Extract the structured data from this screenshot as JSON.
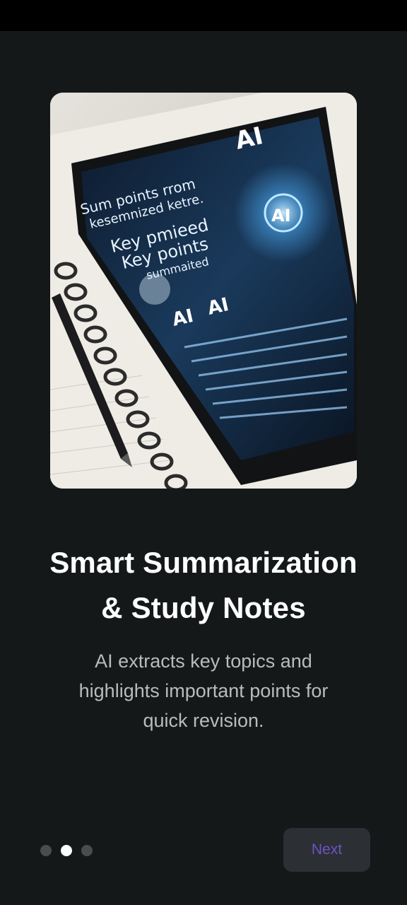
{
  "onboarding": {
    "title_line1": "Smart Summarization",
    "title_line2": "& Study Notes",
    "description_line1": "AI extracts key topics and",
    "description_line2": "highlights important points for",
    "description_line3": "quick revision.",
    "page_indicator": {
      "total": 3,
      "active_index": 1
    },
    "next_label": "Next"
  },
  "illustration": {
    "semantic": "tablet-on-notebook-ai-illustration",
    "text": {
      "line1": "Sum points rrom",
      "line2": "kesemnized ketre.",
      "line3": "Key pmieed",
      "line4": "Key points",
      "line5": "summaited",
      "ai_top": "AI",
      "ai_center": "AI",
      "ai_left": "AI",
      "ai_right": "AI"
    }
  },
  "colors": {
    "background": "#151819",
    "status_bar": "#000000",
    "title": "#ffffff",
    "description": "#b9bcbe",
    "dot_inactive": "#4a4d50",
    "dot_active": "#ffffff",
    "button_bg": "#2c2f33",
    "button_text": "#6f52c7"
  }
}
